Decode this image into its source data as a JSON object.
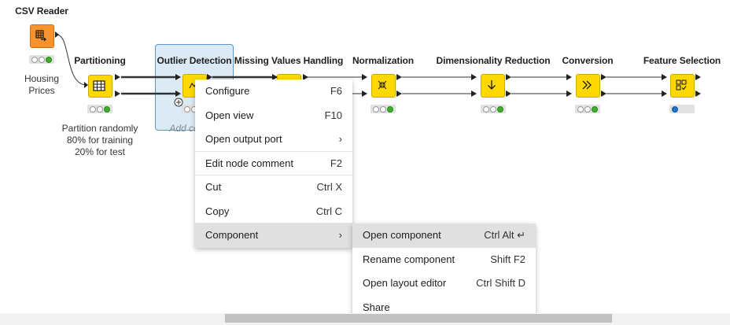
{
  "nodes": [
    {
      "id": "csv-reader",
      "title": "CSV Reader",
      "caption": [
        "Housing",
        "Prices"
      ],
      "icon": "table-arrow-icon",
      "status": [
        "off",
        "off",
        "green"
      ]
    },
    {
      "id": "partitioning",
      "title": "Partitioning",
      "caption": [
        "Partition randomly",
        "80% for training",
        "20% for test"
      ],
      "icon": "grid-icon",
      "status": [
        "off",
        "off",
        "green"
      ]
    },
    {
      "id": "outlier-detection",
      "title": "Outlier Detection",
      "caption": [
        "Add co"
      ],
      "icon": "outlier-icon",
      "status": [
        "off",
        "off",
        "green"
      ]
    },
    {
      "id": "missing-values",
      "title": "Missing Values Handling",
      "caption": [],
      "icon": "component-icon",
      "status": []
    },
    {
      "id": "normalization",
      "title": "Normalization",
      "caption": [],
      "icon": "compress-arrows-icon",
      "status": [
        "off",
        "off",
        "green"
      ]
    },
    {
      "id": "dim-reduction",
      "title": "Dimensionality Reduction",
      "caption": [],
      "icon": "arrow-down-icon",
      "status": [
        "off",
        "off",
        "green"
      ]
    },
    {
      "id": "conversion",
      "title": "Conversion",
      "caption": [],
      "icon": "double-chevron-icon",
      "status": [
        "off",
        "off",
        "green"
      ]
    },
    {
      "id": "feature-selection",
      "title": "Feature Selection",
      "caption": [],
      "icon": "feature-grid-icon",
      "status": [
        "blue"
      ]
    }
  ],
  "context_menu": [
    {
      "label": "Configure",
      "shortcut": "F6"
    },
    {
      "label": "Open view",
      "shortcut": "F10"
    },
    {
      "label": "Open output port",
      "shortcut": "›"
    },
    {
      "label": "Edit node comment",
      "shortcut": "F2"
    },
    {
      "label": "Cut",
      "shortcut": "Ctrl X"
    },
    {
      "label": "Copy",
      "shortcut": "Ctrl C"
    },
    {
      "label": "Component",
      "shortcut": "›"
    }
  ],
  "submenu": [
    {
      "label": "Open component",
      "shortcut": "Ctrl Alt ↵"
    },
    {
      "label": "Rename component",
      "shortcut": "Shift F2"
    },
    {
      "label": "Open layout editor",
      "shortcut": "Ctrl Shift D"
    },
    {
      "label": "Share",
      "shortcut": ""
    }
  ],
  "colors": {
    "node_yellow": "#ffd800",
    "node_orange": "#f7932f",
    "selection": "#dceaf6",
    "status_green": "#3fae29",
    "status_blue": "#1a73c9"
  }
}
